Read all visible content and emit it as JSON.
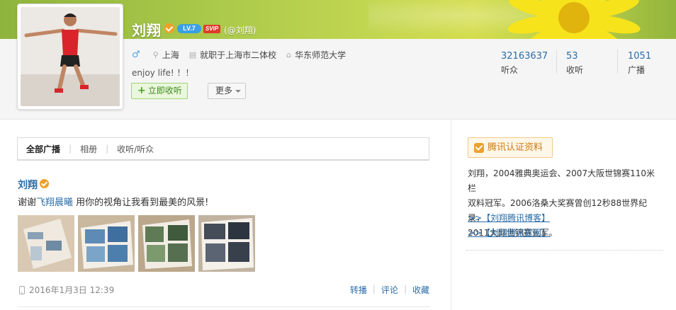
{
  "profile": {
    "name": "刘翔",
    "level_badge": "LV.7",
    "svip_badge": "SVIP",
    "handle": "(@刘翔)",
    "gender_symbol": "♂",
    "location": "上海",
    "job": "就职于上海市二体校",
    "school": "华东师范大学",
    "bio": "enjoy life! ！！",
    "follow_label": "立即收听",
    "more_label": "更多"
  },
  "stats": [
    {
      "value": "32163637",
      "label": "听众"
    },
    {
      "value": "53",
      "label": "收听"
    },
    {
      "value": "1051",
      "label": "广播"
    }
  ],
  "tabs": [
    "全部广播",
    "相册",
    "收听/听众"
  ],
  "post": {
    "author": "刘翔",
    "text_before": "谢谢",
    "mention": "飞翔晨曦",
    "text_after": " 用你的视角让我看到最美的风景!",
    "time": "2016年1月3日 12:39",
    "actions": [
      "转播",
      "评论",
      "收藏"
    ]
  },
  "sidebar": {
    "auth_title": "腾讯认证资料",
    "auth_lines": [
      "刘翔，2004雅典奥运会、2007大阪世锦赛110米栏",
      "双料冠军。2006洛桑大奖赛曾创12秒88世界纪录，",
      "2011大邱世锦赛亚军。"
    ],
    "links": [
      ">>【刘翔腾讯博客】",
      ">>【刘翔腾讯官网】"
    ]
  },
  "colors": {
    "link": "#2a6ca8",
    "verified": "#f0a02a",
    "follow_green": "#3a8a1c"
  }
}
